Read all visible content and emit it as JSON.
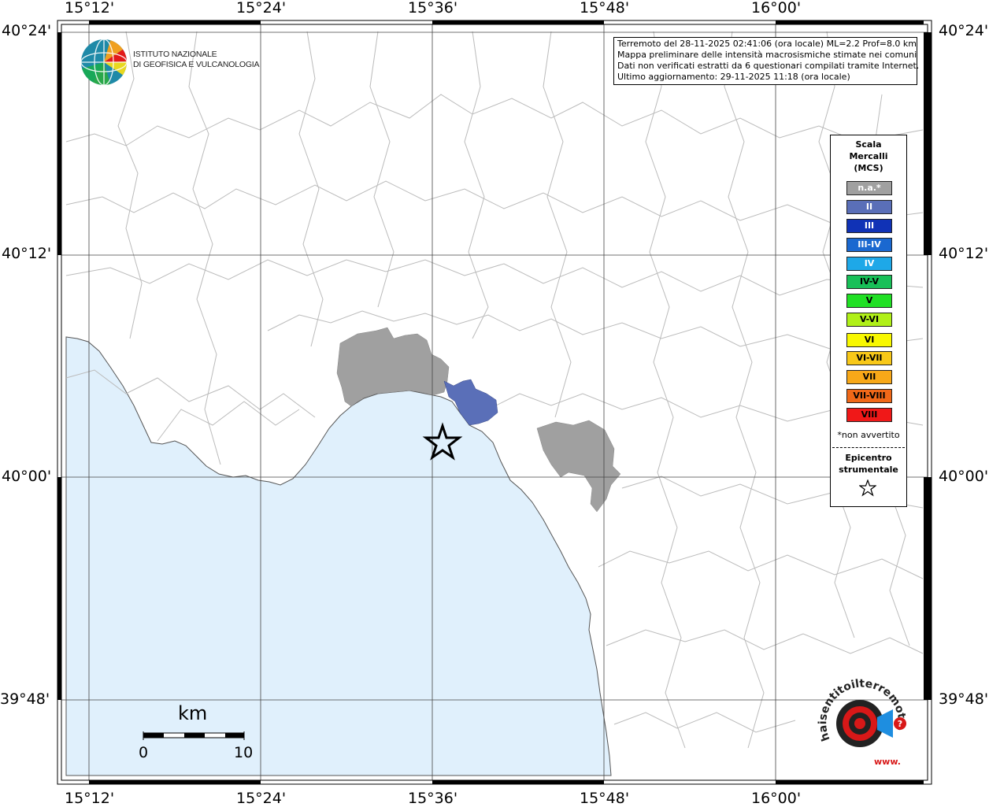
{
  "map": {
    "lon_labels": [
      "15°12'",
      "15°24'",
      "15°36'",
      "15°48'",
      "16°00'"
    ],
    "lat_labels": [
      "40°24'",
      "40°12'",
      "40°00'",
      "39°48'"
    ]
  },
  "info": {
    "line1": "Terremoto del 28-11-2025 02:41:06 (ora locale) ML=2.2 Prof=8.0 km",
    "line2": "Mappa preliminare delle intensità macrosismiche stimate nei comuni",
    "line3": "Dati non verificati estratti da 6 questionari compilati tramite Internet.",
    "line4": "Ultimo aggiornamento: 29-11-2025 11:18 (ora locale)"
  },
  "logo": {
    "line1": "ISTITUTO NAZIONALE",
    "line2": "DI GEOFISICA E VULCANOLOGIA",
    "icon": "ingv-globe-icon"
  },
  "legend": {
    "title_line1": "Scala",
    "title_line2": "Mercalli",
    "title_line3": "(MCS)",
    "items": [
      {
        "label": "n.a.*",
        "color": "#a0a0a0"
      },
      {
        "label": "II",
        "color": "#5a6fb8"
      },
      {
        "label": "III",
        "color": "#1032b6"
      },
      {
        "label": "III-IV",
        "color": "#1a68d0"
      },
      {
        "label": "IV",
        "color": "#1ea8e8"
      },
      {
        "label": "IV-V",
        "color": "#18c058"
      },
      {
        "label": "V",
        "color": "#20e024"
      },
      {
        "label": "V-VI",
        "color": "#b0f018"
      },
      {
        "label": "VI",
        "color": "#f8f800"
      },
      {
        "label": "VI-VII",
        "color": "#f8c818"
      },
      {
        "label": "VII",
        "color": "#f8a818"
      },
      {
        "label": "VII-VIII",
        "color": "#f06818"
      },
      {
        "label": "VIII",
        "color": "#f01818"
      }
    ],
    "note": "*non avvertito",
    "epicentre_line1": "Epicentro",
    "epicentre_line2": "strumentale"
  },
  "scale_bar": {
    "unit": "km",
    "start": "0",
    "end": "10"
  },
  "branding": {
    "text": "haisentitoilterremoto.it",
    "www": "www.",
    "icon": "target-megaphone-icon"
  },
  "colors": {
    "sea": "#e0f0fc",
    "not_felt": "#a0a0a0",
    "intensity_II": "#5a6fb8",
    "borders": "#bbbbbb"
  }
}
